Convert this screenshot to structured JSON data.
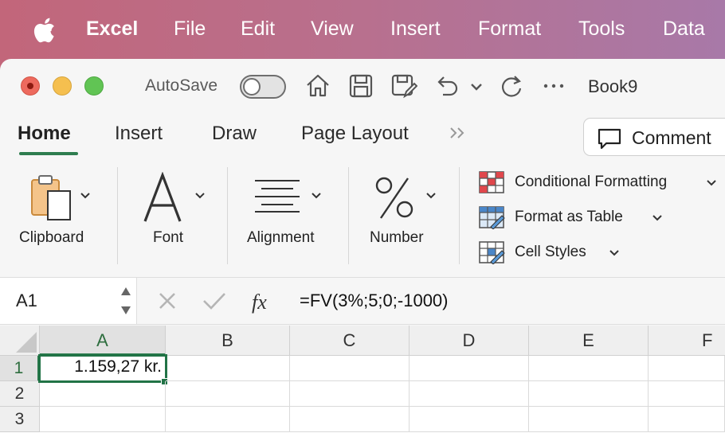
{
  "menubar": {
    "app_name": "Excel",
    "items": [
      "File",
      "Edit",
      "View",
      "Insert",
      "Format",
      "Tools",
      "Data"
    ]
  },
  "titlebar": {
    "autosave_label": "AutoSave",
    "autosave_on": false,
    "document_title": "Book9"
  },
  "ribbon": {
    "tabs": [
      "Home",
      "Insert",
      "Draw",
      "Page Layout"
    ],
    "active_tab": "Home",
    "comments_label": "Comment",
    "groups": {
      "clipboard": "Clipboard",
      "font": "Font",
      "alignment": "Alignment",
      "number": "Number"
    },
    "styles": {
      "conditional_formatting": "Conditional Formatting",
      "format_as_table": "Format as Table",
      "cell_styles": "Cell Styles"
    }
  },
  "formula_bar": {
    "name_box": "A1",
    "formula": "=FV(3%;5;0;-1000)"
  },
  "grid": {
    "columns": [
      "A",
      "B",
      "C",
      "D",
      "E",
      "F"
    ],
    "rows": [
      "1",
      "2",
      "3"
    ],
    "active_cell": "A1",
    "cells": {
      "A1": "1.159,27 kr."
    }
  },
  "colors": {
    "accent": "#217346",
    "menubar_gradient_start": "#c2667a",
    "menubar_gradient_end": "#a879a8"
  }
}
